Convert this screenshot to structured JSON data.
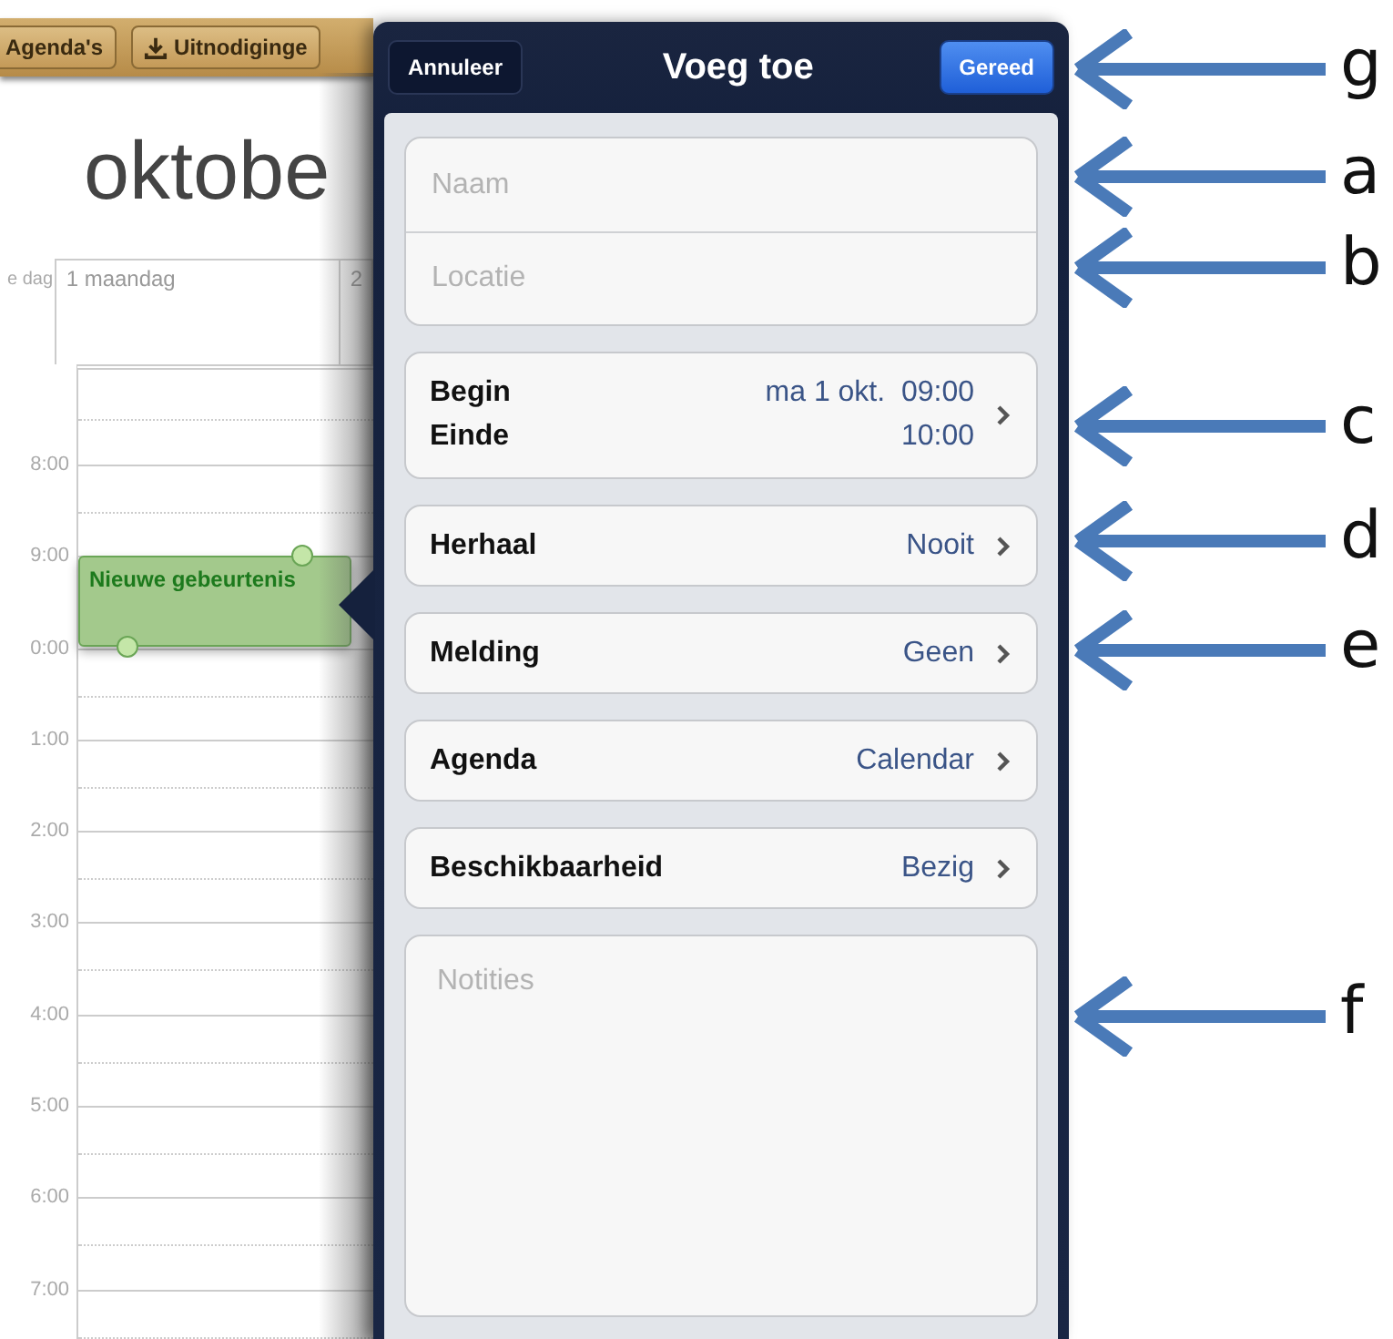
{
  "toolbar": {
    "buttons": [
      {
        "label": "Agenda's",
        "kind": "plain"
      },
      {
        "label": "Uitnodiginge",
        "kind": "download"
      }
    ]
  },
  "month_title": "oktobe",
  "all_day_label": "e dag",
  "day_headers": [
    "1 maandag",
    "2"
  ],
  "hours": [
    "8:00",
    "9:00",
    "0:00",
    "1:00",
    "2:00",
    "3:00",
    "4:00",
    "5:00",
    "6:00",
    "7:00"
  ],
  "event": {
    "title": "Nieuwe gebeurtenis"
  },
  "popover": {
    "cancel": "Annuleer",
    "title": "Voeg toe",
    "done": "Gereed",
    "fields": [
      {
        "placeholder": "Naam"
      },
      {
        "placeholder": "Locatie"
      }
    ],
    "time": {
      "begin_label": "Begin",
      "end_label": "Einde",
      "begin_value": "ma 1 okt.  09:00",
      "end_value": "10:00"
    },
    "rows": [
      {
        "label": "Herhaal",
        "value": "Nooit"
      },
      {
        "label": "Melding",
        "value": "Geen"
      },
      {
        "label": "Agenda",
        "value": "Calendar"
      },
      {
        "label": "Beschikbaarheid",
        "value": "Bezig"
      }
    ],
    "notes": {
      "placeholder": "Notities"
    }
  },
  "annotations": [
    {
      "letter": "g"
    },
    {
      "letter": "a"
    },
    {
      "letter": "b"
    },
    {
      "letter": "c"
    },
    {
      "letter": "d"
    },
    {
      "letter": "e"
    },
    {
      "letter": "f"
    }
  ]
}
